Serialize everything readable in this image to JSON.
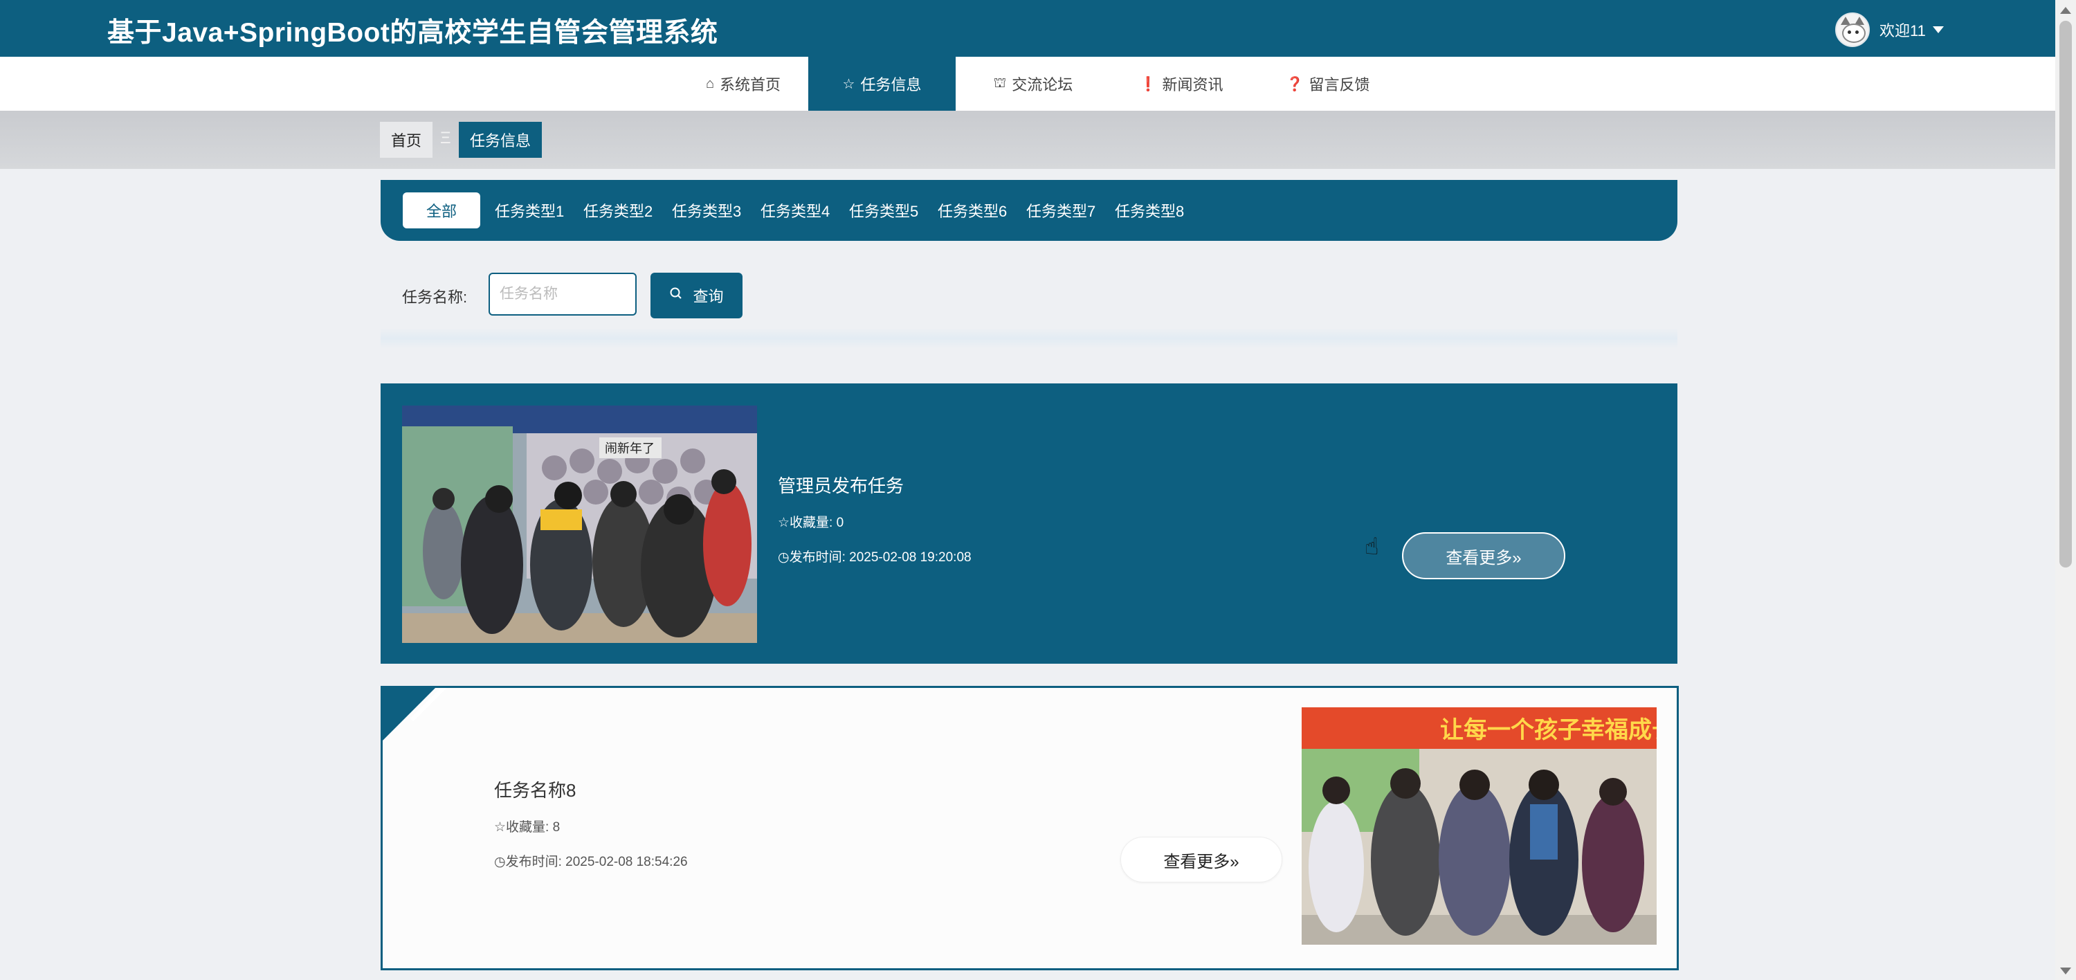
{
  "header": {
    "title": "基于Java+SpringBoot的高校学生自管会管理系统",
    "user_greeting": "欢迎11"
  },
  "nav": [
    {
      "label": "系统首页",
      "icon": "⌂"
    },
    {
      "label": "任务信息",
      "icon": "☆"
    },
    {
      "label": "交流论坛",
      "icon": "⛫"
    },
    {
      "label": "新闻资讯",
      "icon": "❗"
    },
    {
      "label": "留言反馈",
      "icon": "❓"
    }
  ],
  "breadcrumb": {
    "home": "首页",
    "separator": "Ξ",
    "current": "任务信息"
  },
  "categories": [
    "全部",
    "任务类型1",
    "任务类型2",
    "任务类型3",
    "任务类型4",
    "任务类型5",
    "任务类型6",
    "任务类型7",
    "任务类型8"
  ],
  "search": {
    "label": "任务名称:",
    "placeholder": "任务名称",
    "button": "查询"
  },
  "tasks": [
    {
      "title": "管理员发布任务",
      "favorites": "收藏量: 0",
      "published": "发布时间: 2025-02-08 19:20:08",
      "more": "查看更多»"
    },
    {
      "title": "任务名称8",
      "favorites": "收藏量: 8",
      "published": "发布时间: 2025-02-08 18:54:26",
      "more": "查看更多»"
    }
  ],
  "images": {
    "card1_sign_text": "闹新年了",
    "card2_banner_text": "让每一个孩子幸福成长"
  },
  "colors": {
    "primary": "#0d5f80",
    "page_bg": "#eef0f3"
  }
}
